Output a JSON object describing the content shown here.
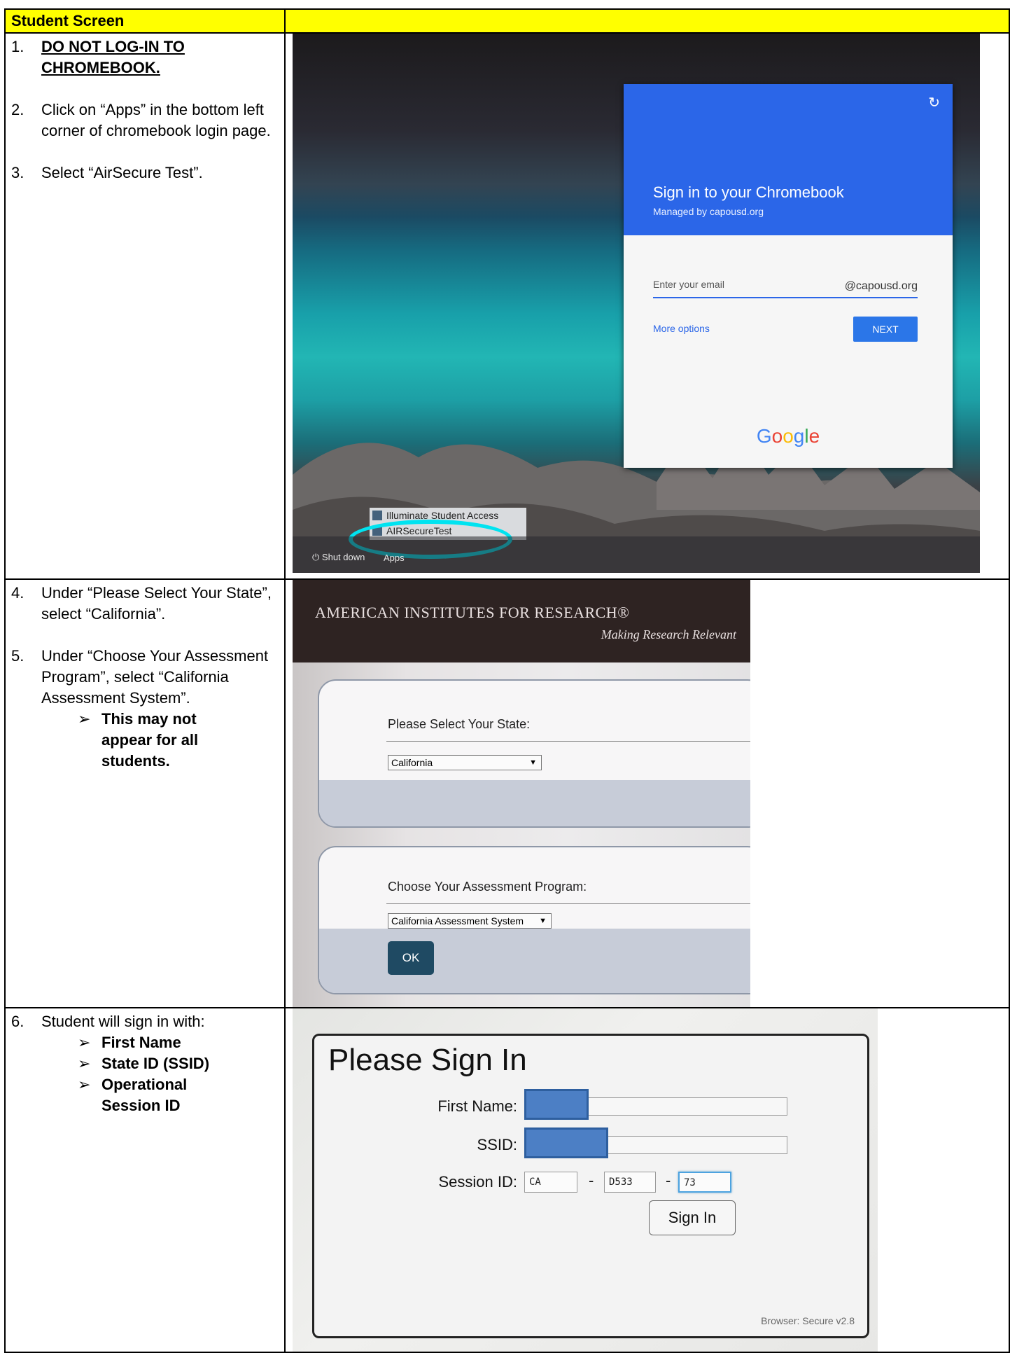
{
  "header": {
    "col1": "Student Screen",
    "col2": ""
  },
  "row1": {
    "steps": [
      {
        "num": "1.",
        "text": "DO NOT LOG-IN TO CHROMEBOOK."
      },
      {
        "num": "2.",
        "text": "Click on “Apps” in the bottom left corner of chromebook login page."
      },
      {
        "num": "3.",
        "text": "Select “AirSecure Test”."
      }
    ],
    "photo": {
      "title": "Sign in to your Chromebook",
      "subtitle": "Managed by capousd.org",
      "email_placeholder": "Enter your email",
      "email_domain": "@capousd.org",
      "more_options": "More options",
      "next": "NEXT",
      "google": [
        "G",
        "o",
        "o",
        "g",
        "l",
        "e"
      ],
      "shutdown": "Shut down",
      "apps": "Apps",
      "menu_items": [
        "Illuminate Student Access",
        "AIRSecureTest"
      ],
      "highlight_color": "#00e3f0"
    }
  },
  "row2": {
    "steps": [
      {
        "num": "4.",
        "text": "Under “Please Select Your State”, select “California”."
      },
      {
        "num": "5.",
        "text": "Under “Choose Your Assessment Program”, select “California Assessment System”."
      }
    ],
    "bullet": "This may not appear for all students.",
    "photo": {
      "org": "AMERICAN INSTITUTES FOR RESEARCH®",
      "motto": "Making Research Relevant",
      "state_label": "Please Select Your State:",
      "state_value": "California",
      "program_label": "Choose Your Assessment Program:",
      "program_value": "California Assessment System",
      "ok": "OK"
    }
  },
  "row3": {
    "step": {
      "num": "6.",
      "text": "Student will sign in with:"
    },
    "bullets": [
      "First Name",
      "State ID (SSID)",
      "Operational Session ID"
    ],
    "photo": {
      "title": "Please Sign In",
      "first_name_label": "First Name:",
      "ssid_label": "SSID:",
      "session_label": "Session ID:",
      "session_parts": [
        "CA",
        "D533",
        "73"
      ],
      "dash": "-",
      "sign_in": "Sign In",
      "version": "Browser: Secure v2.8"
    }
  },
  "colors": {
    "header_yellow": "#ffff00",
    "chrome_blue": "#2b66e8",
    "air_dark": "#2e2322"
  }
}
